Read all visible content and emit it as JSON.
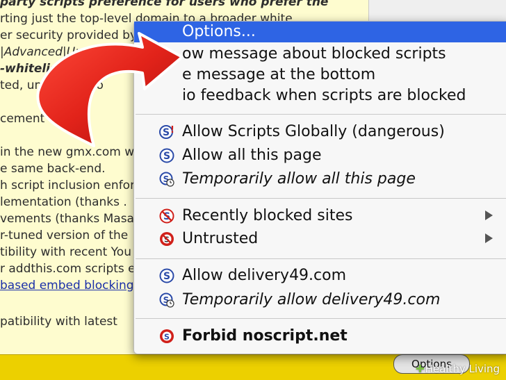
{
  "background_text": [
    {
      "text": "party scripts preference for users who prefer the",
      "style": "mixed"
    },
    {
      "text": "rting just the top-level domain to a broader white",
      "style": ""
    },
    {
      "text": "er security provided by",
      "style": ""
    },
    {
      "text": "|Advanced|Untrust",
      "style": "it"
    },
    {
      "text": "-whitelisted pages",
      "style": "bi"
    },
    {
      "text": "ted, unless the to",
      "style": ""
    },
    {
      "text": "cement",
      "style": ""
    },
    {
      "text": "in the new gmx.com we",
      "style": ""
    },
    {
      "text": "e same back-end.",
      "style": ""
    },
    {
      "text": "h script inclusion enfor",
      "style": ""
    },
    {
      "text": "lementation (thanks .",
      "style": ""
    },
    {
      "text": "vements (thanks Masat",
      "style": ""
    },
    {
      "text": "r-tuned version of the",
      "style": ""
    },
    {
      "text": "tibility with recent You",
      "style": ""
    },
    {
      "text": "r addthis.com scripts e",
      "style": ""
    },
    {
      "text": "based embed blocking",
      "style": "link"
    },
    {
      "text": "patibility with latest",
      "style": ""
    }
  ],
  "menu": {
    "items": [
      {
        "label": "Options...",
        "selected": true,
        "icon": null,
        "style": ""
      },
      {
        "label": "ow message about blocked scripts",
        "icon": null,
        "style": ""
      },
      {
        "label": "e message at the bottom",
        "icon": null,
        "style": ""
      },
      {
        "label": "io feedback when scripts are blocked",
        "icon": null,
        "style": ""
      },
      {
        "label": "Allow Scripts Globally (dangerous)",
        "icon": "noscript-globally-icon",
        "style": ""
      },
      {
        "label": "Allow all this page",
        "icon": "noscript-allow-icon",
        "style": ""
      },
      {
        "label": "Temporarily allow all this page",
        "icon": "noscript-temp-icon",
        "style": "it"
      },
      {
        "label": "Recently blocked sites",
        "icon": "noscript-recent-icon",
        "style": "",
        "submenu": true
      },
      {
        "label": "Untrusted",
        "icon": "noscript-untrusted-icon",
        "style": "",
        "submenu": true
      },
      {
        "label": "Allow delivery49.com",
        "icon": "noscript-allow-icon",
        "style": ""
      },
      {
        "label": "Temporarily allow delivery49.com",
        "icon": "noscript-temp-icon",
        "style": "it"
      },
      {
        "label": "Forbid noscript.net",
        "icon": "noscript-forbid-icon",
        "style": "b"
      }
    ]
  },
  "statusbar": {
    "options_button": "Options"
  },
  "watermark": {
    "cross": "✚",
    "text": "Healthy Living"
  },
  "colors": {
    "page_bg": "#fefccf",
    "menu_bg": "#f7f7f7",
    "selection": "#2e64e4",
    "statusbar": "#ecd000",
    "arrow": "#e2231a",
    "noscript_blue": "#2a4aa8",
    "noscript_red": "#d0201a"
  }
}
